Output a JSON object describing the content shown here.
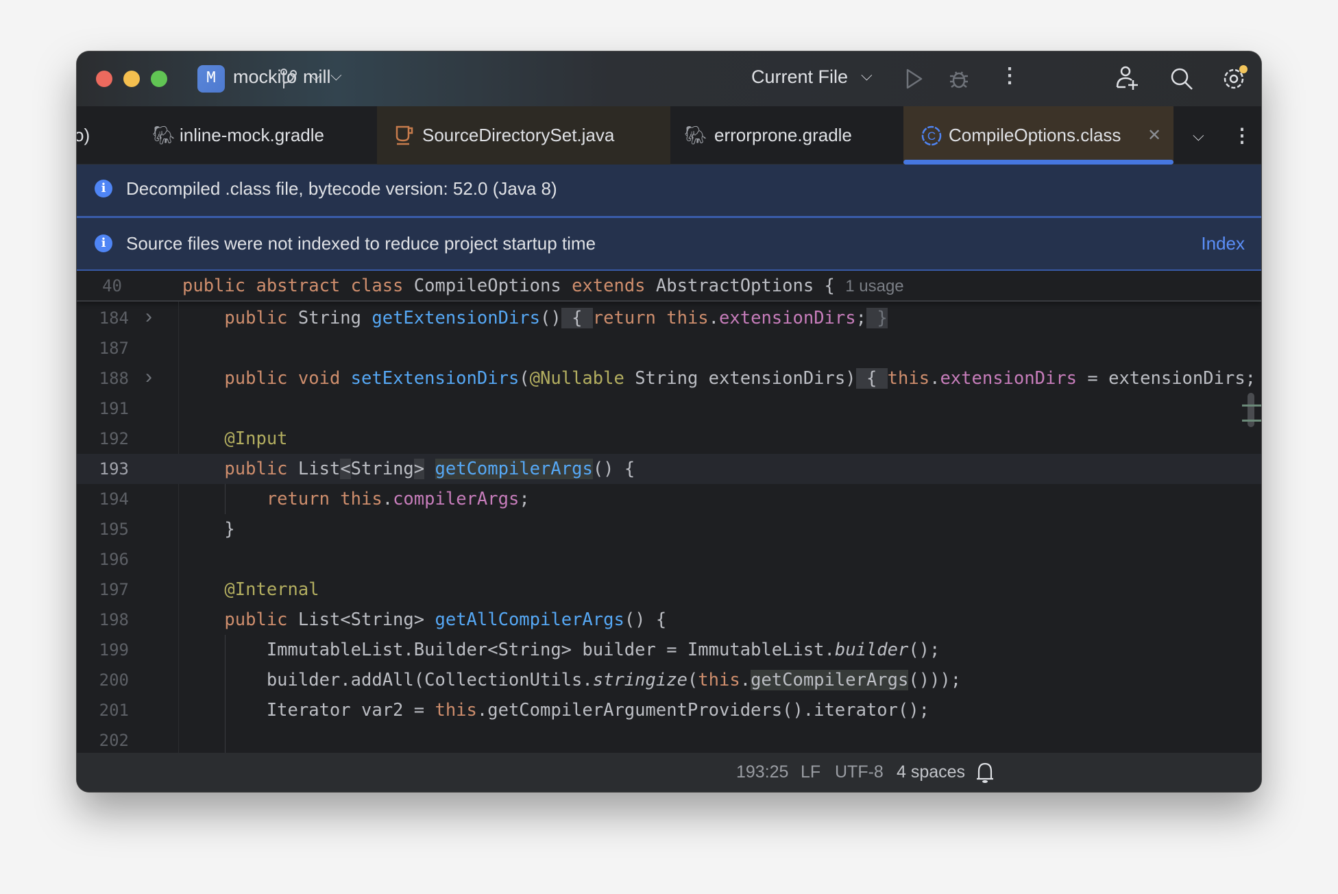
{
  "titlebar": {
    "project_initial": "M",
    "project": "mockito",
    "branch": "mill",
    "run_config": "Current File"
  },
  "tabs": [
    {
      "label": "o)",
      "icon": "partial"
    },
    {
      "label": "inline-mock.gradle",
      "icon": "gradle-elephant-icon"
    },
    {
      "label": "SourceDirectorySet.java",
      "icon": "java-cup-icon"
    },
    {
      "label": "errorprone.gradle",
      "icon": "gradle-elephant-icon"
    },
    {
      "label": "CompileOptions.class",
      "icon": "class-c-icon",
      "active": true
    }
  ],
  "banners": [
    {
      "text": "Decompiled .class file, bytecode version: 52.0 (Java 8)"
    },
    {
      "text": "Source files were not indexed to reduce project startup time",
      "action": "Index"
    }
  ],
  "sticky": {
    "line": "40",
    "tokens": [
      [
        "public abstract class ",
        "kw"
      ],
      [
        "CompileOptions ",
        "pl"
      ],
      [
        "extends ",
        "kw"
      ],
      [
        "AbstractOptions { ",
        "pl"
      ]
    ],
    "hint": "1 usage"
  },
  "code": [
    {
      "n": "184",
      "fold": true,
      "tokens": [
        [
          "    ",
          "pl"
        ],
        [
          "public ",
          "kw"
        ],
        [
          "String ",
          "pl"
        ],
        [
          "getExtensionDirs",
          "fn"
        ],
        [
          "()",
          "pl"
        ],
        [
          " { ",
          "pl",
          "hl"
        ],
        [
          "return this",
          "kw"
        ],
        [
          ".",
          "pl"
        ],
        [
          "extensionDirs",
          "fd"
        ],
        [
          ";",
          "pl"
        ],
        [
          " }",
          "dim",
          "hl"
        ]
      ]
    },
    {
      "n": "187",
      "tokens": []
    },
    {
      "n": "188",
      "fold": true,
      "tokens": [
        [
          "    ",
          "pl"
        ],
        [
          "public void ",
          "kw"
        ],
        [
          "setExtensionDirs",
          "fn"
        ],
        [
          "(",
          "pl"
        ],
        [
          "@Nullable ",
          "an"
        ],
        [
          "String extensionDirs)",
          "pl"
        ],
        [
          " { ",
          "pl",
          "hl"
        ],
        [
          "this",
          "kw"
        ],
        [
          ".",
          "pl"
        ],
        [
          "extensionDirs",
          "fd"
        ],
        [
          " = extensionDirs;",
          "pl"
        ]
      ]
    },
    {
      "n": "191",
      "tokens": []
    },
    {
      "n": "192",
      "tokens": [
        [
          "    ",
          "pl"
        ],
        [
          "@Input",
          "an"
        ]
      ]
    },
    {
      "n": "193",
      "current": true,
      "tokens": [
        [
          "    ",
          "pl"
        ],
        [
          "public ",
          "kw"
        ],
        [
          "List",
          "pl"
        ],
        [
          "<",
          "pl",
          "hl"
        ],
        [
          "String",
          "pl"
        ],
        [
          ">",
          "pl",
          "hl"
        ],
        [
          " ",
          "pl"
        ],
        [
          "getCompilerArgs",
          "fn",
          "us"
        ],
        [
          "() {",
          "pl"
        ]
      ]
    },
    {
      "n": "194",
      "tokens": [
        [
          "        ",
          "pl"
        ],
        [
          "return this",
          "kw"
        ],
        [
          ".",
          "pl"
        ],
        [
          "compilerArgs",
          "fd"
        ],
        [
          ";",
          "pl"
        ]
      ]
    },
    {
      "n": "195",
      "tokens": [
        [
          "    }",
          "pl"
        ]
      ]
    },
    {
      "n": "196",
      "tokens": []
    },
    {
      "n": "197",
      "tokens": [
        [
          "    ",
          "pl"
        ],
        [
          "@Internal",
          "an"
        ]
      ]
    },
    {
      "n": "198",
      "tokens": [
        [
          "    ",
          "pl"
        ],
        [
          "public ",
          "kw"
        ],
        [
          "List<String> ",
          "pl"
        ],
        [
          "getAllCompilerArgs",
          "fn"
        ],
        [
          "() {",
          "pl"
        ]
      ]
    },
    {
      "n": "199",
      "tokens": [
        [
          "        ImmutableList.Builder<String> builder = ImmutableList.",
          "pl"
        ],
        [
          "builder",
          "pl it"
        ],
        [
          "();",
          "pl"
        ]
      ]
    },
    {
      "n": "200",
      "tokens": [
        [
          "        builder.addAll(CollectionUtils.",
          "pl"
        ],
        [
          "stringize",
          "pl it"
        ],
        [
          "(",
          "pl"
        ],
        [
          "this",
          "kw"
        ],
        [
          ".",
          "pl"
        ],
        [
          "getCompilerArgs",
          "pl",
          "us"
        ],
        [
          "()));",
          "pl"
        ]
      ]
    },
    {
      "n": "201",
      "tokens": [
        [
          "        Iterator var2 = ",
          "pl"
        ],
        [
          "this",
          "kw"
        ],
        [
          ".getCompilerArgumentProviders().iterator();",
          "pl"
        ]
      ]
    },
    {
      "n": "202",
      "tokens": []
    }
  ],
  "status": {
    "position": "193:25",
    "line_ending": "LF",
    "encoding": "UTF-8",
    "indent": "4 spaces"
  },
  "colors": {
    "accent": "#4f85f5",
    "keyword": "#cf8e6d",
    "function": "#56a8f5",
    "field": "#c77dbb",
    "annotation": "#b3ae60"
  }
}
